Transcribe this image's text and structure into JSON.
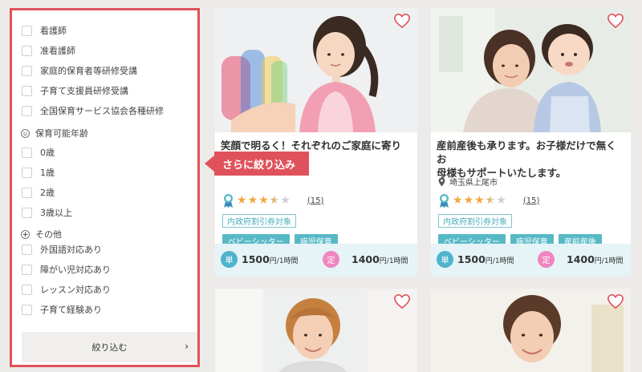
{
  "filters": {
    "quals": [
      "看護師",
      "准看護師",
      "家庭的保育者等研修受講",
      "子育て支援員研修受講",
      "全国保育サービス協会各種研修"
    ],
    "age_section": "保育可能年齢",
    "ages": [
      "0歳",
      "1歳",
      "2歳",
      "3歳以上"
    ],
    "other_section": "その他",
    "others": [
      "外国語対応あり",
      "障がい児対応あり",
      "レッスン対応あり",
      "子育て経験あり"
    ],
    "submit_label": "絞り込む",
    "submit_chevron": "›"
  },
  "callout": "さらに絞り込み",
  "cards": [
    {
      "title_line1": "笑顔で明るく！それぞれのご家庭に寄り添",
      "location": "",
      "rating": 3.5,
      "review_count": "(15)",
      "outline_tag": "内政府割引券対象",
      "tags": [
        "ベビーシッター",
        "病児保育"
      ],
      "price1_badge": "単",
      "price1_value": "1500",
      "price1_unit": "円/1時間",
      "price2_badge": "定",
      "price2_value": "1400",
      "price2_unit": "円/1時間"
    },
    {
      "title_line1": "産前産後も承ります。お子様だけで無くお",
      "title_line2": "母様もサポートいたします。",
      "location": "埼玉県上尾市",
      "rating": 3.5,
      "review_count": "(15)",
      "outline_tag": "内政府割引券対象",
      "tags": [
        "ベビーシッター",
        "病児保育",
        "産前産後"
      ],
      "price1_badge": "単",
      "price1_value": "1500",
      "price1_unit": "円/1時間",
      "price2_badge": "定",
      "price2_value": "1400",
      "price2_unit": "円/1時間"
    }
  ],
  "colors": {
    "sidebar_border": "#e0525b",
    "callout_bg": "#e0525b",
    "tag_teal": "#58b9c6",
    "price_single": "#4fb3cc",
    "price_fixed": "#ef86c0",
    "star": "#f3a73c",
    "heart": "#e0525b"
  },
  "icons": [
    "heart-icon",
    "map-pin-icon",
    "award-ribbon-icon",
    "star-icon",
    "checkbox-icon",
    "chevron-right-icon",
    "plus-circle-icon",
    "smile-icon"
  ]
}
